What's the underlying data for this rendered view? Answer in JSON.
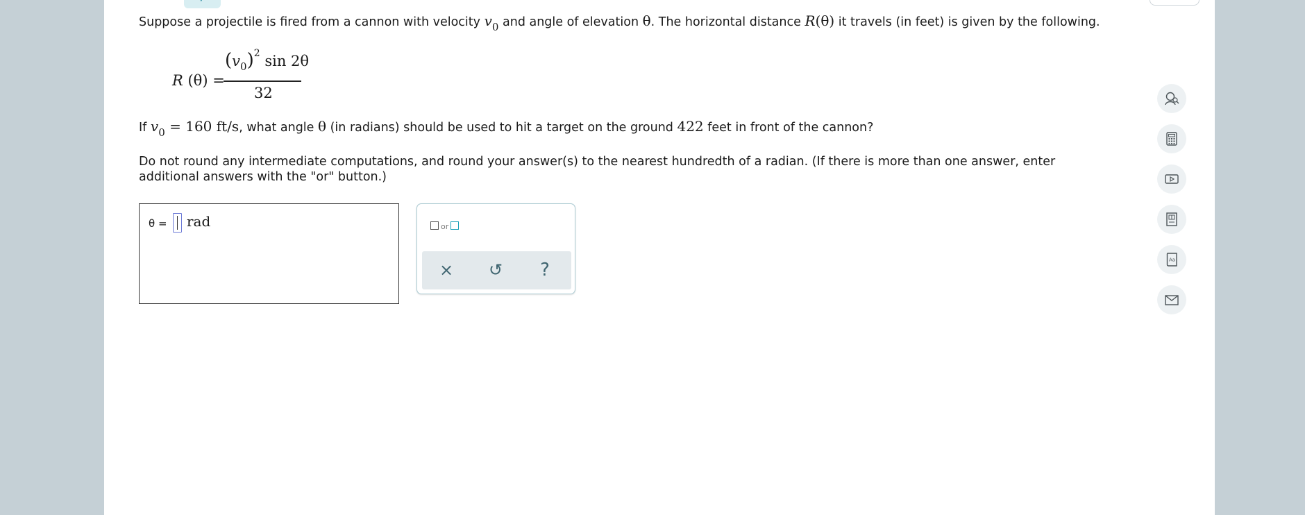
{
  "problem": {
    "intro_a": "Suppose a projectile is fired from a cannon with velocity ",
    "v": "v",
    "v_sub": "0",
    "intro_b": " and angle of elevation ",
    "theta": "θ",
    "intro_c": ". The horizontal distance ",
    "R": "R",
    "R_arg": "(θ)",
    "intro_d": " it travels (in feet) is given by the following.",
    "formula": {
      "lhs_R": "R",
      "lhs_arg": " (θ) =",
      "num_open": "(",
      "num_v": "v",
      "num_sub": "0",
      "num_close": ")",
      "num_sup": "2",
      "num_sin": " sin 2θ",
      "den": "32"
    },
    "q_if": "If ",
    "q_v": "v",
    "q_sub": "0",
    "q_eq": " = 160 ft/s",
    "q_a": ", what angle ",
    "q_theta": "θ",
    "q_b": " (in radians) should be used to hit a target on the ground ",
    "q_dist": "422",
    "q_c": " feet in front of the cannon?",
    "instr_line1": "Do not round any intermediate computations, and round your answer(s) to the nearest hundredth of a radian. (If there is more than one answer, enter",
    "instr_line2": "additional answers with the \"or\" button.)"
  },
  "answer": {
    "label": "θ =",
    "value": "",
    "unit": "rad"
  },
  "tools": {
    "or_label": "or",
    "clear_icon": "×",
    "undo_icon": "↺",
    "help_icon": "?"
  },
  "sidebar": {
    "icons": [
      "ask-tutor-icon",
      "calculator-icon",
      "video-icon",
      "textbook-icon",
      "dictionary-icon",
      "message-icon"
    ]
  }
}
